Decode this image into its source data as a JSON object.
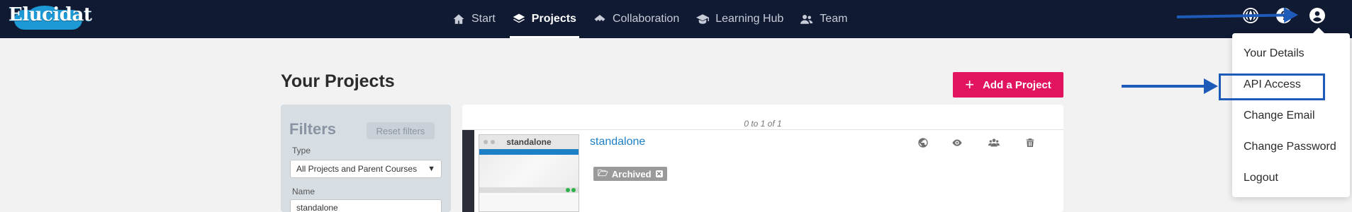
{
  "app": {
    "logo_text": "Elucidat"
  },
  "nav": {
    "items": [
      {
        "label": "Start",
        "icon": "home-icon"
      },
      {
        "label": "Projects",
        "icon": "layers-icon",
        "active": true
      },
      {
        "label": "Collaboration",
        "icon": "handshake-icon"
      },
      {
        "label": "Learning Hub",
        "icon": "graduation-cap-icon"
      },
      {
        "label": "Team",
        "icon": "users-icon"
      }
    ]
  },
  "top_icons": [
    "globe-icon",
    "help-icon",
    "user-circle-icon"
  ],
  "user_menu": {
    "items": [
      "Your Details",
      "API Access",
      "Change Email",
      "Change Password",
      "Logout"
    ],
    "highlighted": "API Access"
  },
  "main": {
    "title": "Your Projects",
    "add_button_label": "Add a Project"
  },
  "filters": {
    "title": "Filters",
    "reset_label": "Reset filters",
    "type_label": "Type",
    "type_value": "All Projects and Parent Courses",
    "name_label": "Name",
    "name_value": "standalone"
  },
  "list": {
    "count_text": "0 to 1 of 1",
    "rows": [
      {
        "name": "standalone",
        "thumbnail_title": "standalone",
        "badge": "Archived",
        "actions": [
          "globe-icon",
          "eye-icon",
          "users-icon",
          "trash-icon"
        ]
      }
    ]
  },
  "colors": {
    "topbar": "#101a33",
    "accent": "#e2135f",
    "link": "#1d7fc4",
    "annotation": "#1e5bb8"
  }
}
